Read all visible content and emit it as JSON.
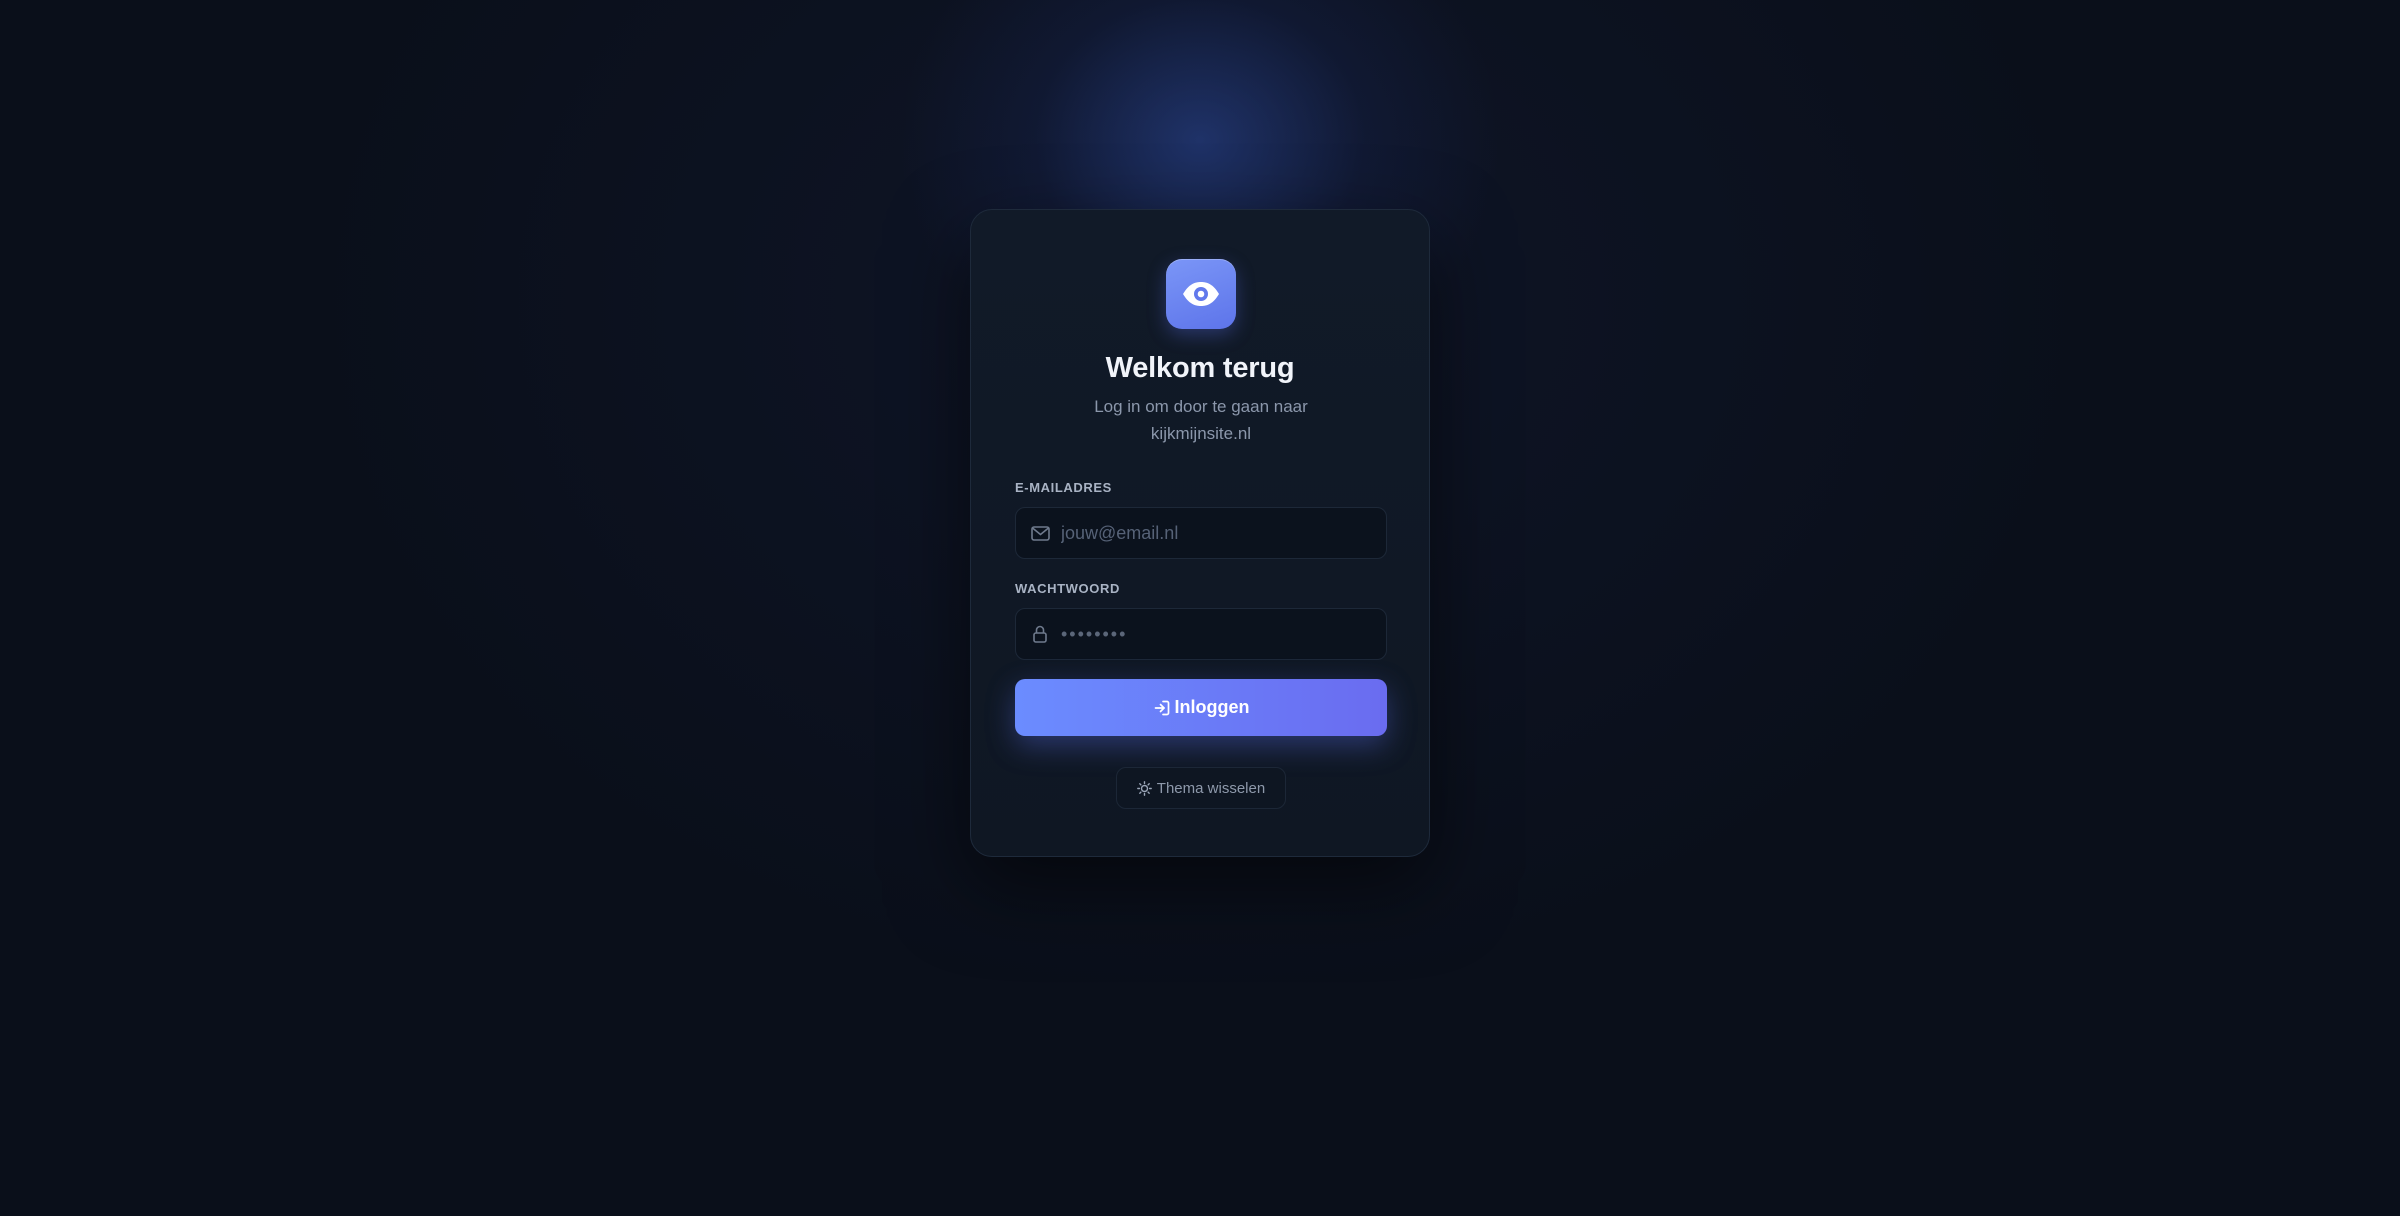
{
  "login": {
    "logo_icon": "eye-icon",
    "title": "Welkom terug",
    "subtitle": "Log in om door te gaan naar kijkmijnsite.nl",
    "email": {
      "label": "E-MAILADRES",
      "placeholder": "jouw@email.nl",
      "value": "",
      "icon": "mail-icon"
    },
    "password": {
      "label": "WACHTWOORD",
      "placeholder": "••••••••",
      "value": "",
      "icon": "lock-icon"
    },
    "submit_label": "Inloggen",
    "submit_icon": "login-arrow-icon",
    "theme_toggle_label": "Thema wisselen",
    "theme_toggle_icon": "sun-icon"
  },
  "colors": {
    "background": "#0a0f1a",
    "card": "#111a28",
    "accent_start": "#6b8cff",
    "accent_end": "#6a6cf0",
    "text_primary": "#f1f4fa",
    "text_muted": "#8b97ab"
  }
}
